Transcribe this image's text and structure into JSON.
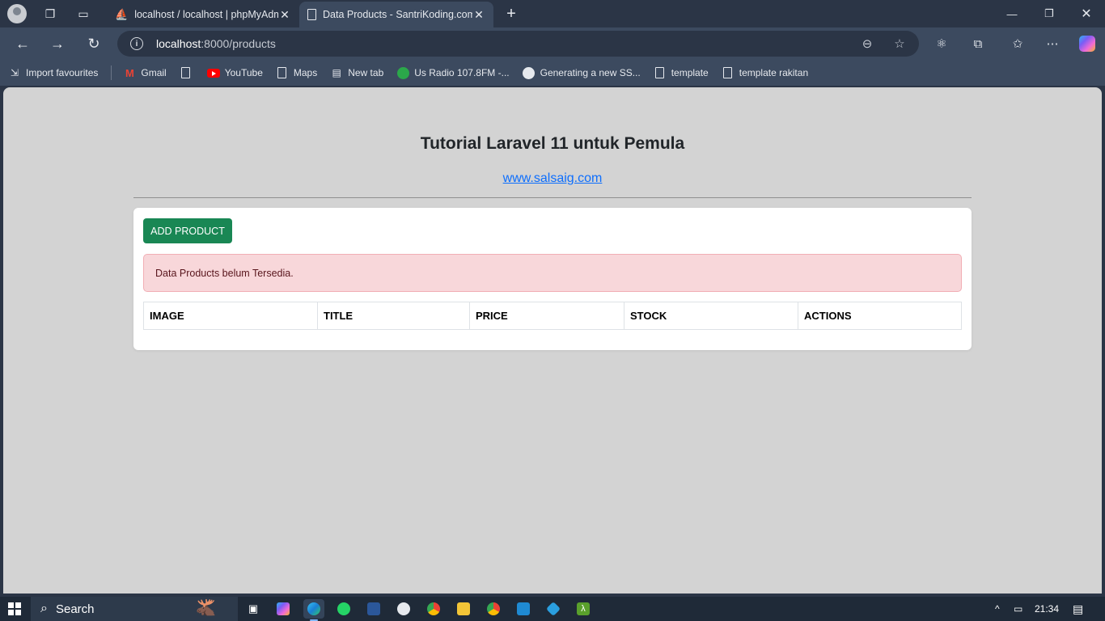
{
  "browser": {
    "tabs": [
      {
        "title": "localhost / localhost | phpMyAdm",
        "active": false
      },
      {
        "title": "Data Products - SantriKoding.com",
        "active": true
      }
    ],
    "address": {
      "host": "localhost",
      "rest": ":8000/products"
    },
    "bookmarks": [
      {
        "label": "Import favourites",
        "icon": "import-icon"
      },
      {
        "label": "Gmail",
        "icon": "gmail-icon"
      },
      {
        "label": "",
        "icon": "document-icon"
      },
      {
        "label": "YouTube",
        "icon": "youtube-icon"
      },
      {
        "label": "Maps",
        "icon": "document-icon"
      },
      {
        "label": "New tab",
        "icon": "newtab-icon"
      },
      {
        "label": "Us Radio 107.8FM -...",
        "icon": "radio-icon"
      },
      {
        "label": "Generating a new SS...",
        "icon": "github-icon"
      },
      {
        "label": "template",
        "icon": "document-icon"
      },
      {
        "label": "template rakitan",
        "icon": "document-icon"
      }
    ]
  },
  "page": {
    "heading": "Tutorial Laravel 11 untuk Pemula",
    "link": "www.salsaig.com",
    "add_button": "ADD PRODUCT",
    "alert": "Data Products belum Tersedia.",
    "table_headers": [
      "IMAGE",
      "TITLE",
      "PRICE",
      "STOCK",
      "ACTIONS"
    ]
  },
  "taskbar": {
    "search_label": "Search",
    "time": "21:34"
  },
  "colors": {
    "success": "#198754",
    "danger_bg": "#f8d7da",
    "link": "#0d6efd",
    "page_bg": "#d3d3d3"
  }
}
